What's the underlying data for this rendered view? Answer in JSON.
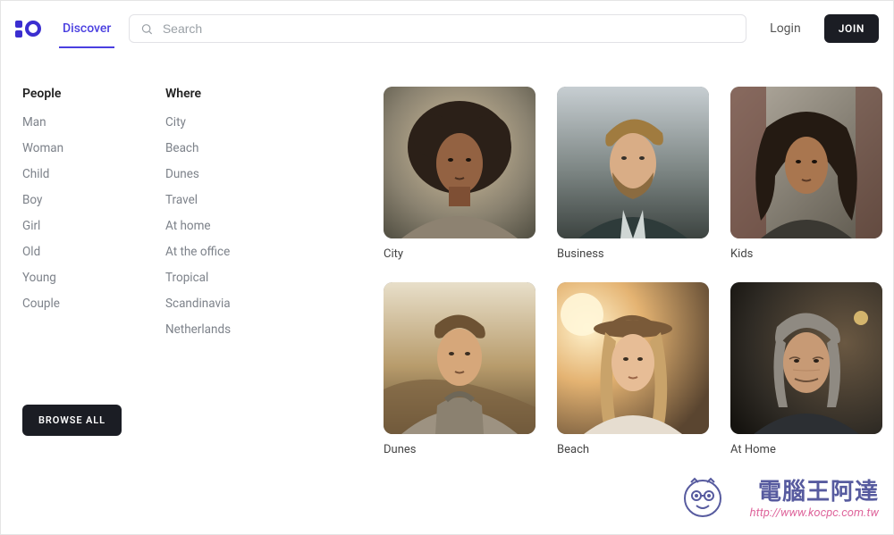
{
  "header": {
    "nav_discover": "Discover",
    "search_placeholder": "Search",
    "login": "Login",
    "join": "JOIN"
  },
  "filters": {
    "people": {
      "heading": "People",
      "items": [
        "Man",
        "Woman",
        "Child",
        "Boy",
        "Girl",
        "Old",
        "Young",
        "Couple"
      ]
    },
    "where": {
      "heading": "Where",
      "items": [
        "City",
        "Beach",
        "Dunes",
        "Travel",
        "At home",
        "At the office",
        "Tropical",
        "Scandinavia",
        "Netherlands"
      ]
    }
  },
  "browse_all": "BROWSE ALL",
  "cards": [
    {
      "label": "City"
    },
    {
      "label": "Business"
    },
    {
      "label": "Kids"
    },
    {
      "label": "Dunes"
    },
    {
      "label": "Beach"
    },
    {
      "label": "At Home"
    }
  ],
  "watermark": {
    "main": "電腦王阿達",
    "sub": "http://www.kocpc.com.tw"
  }
}
